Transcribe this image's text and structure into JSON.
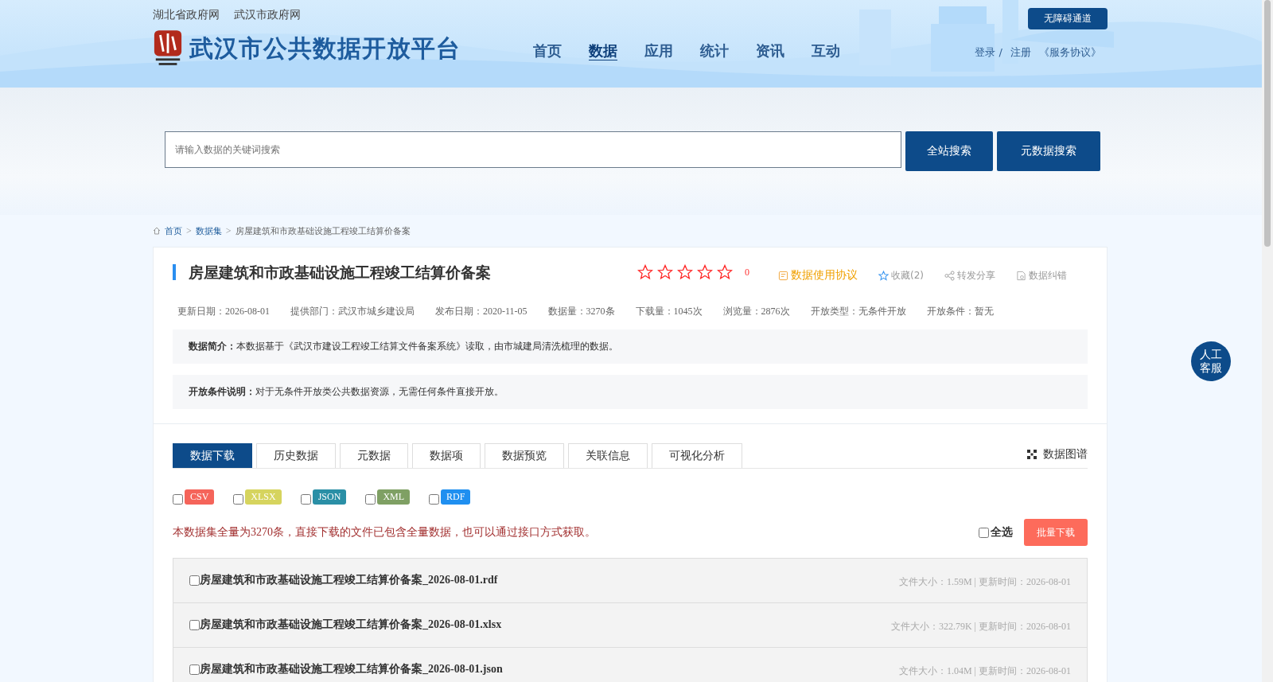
{
  "top_links": [
    "湖北省政府网",
    "武汉市政府网"
  ],
  "accessibility_button": "无障碍通道",
  "site_title": "武汉市公共数据开放平台",
  "nav": [
    {
      "label": "首页",
      "selected": false
    },
    {
      "label": "数据",
      "selected": true
    },
    {
      "label": "应用",
      "selected": false
    },
    {
      "label": "统计",
      "selected": false
    },
    {
      "label": "资讯",
      "selected": false
    },
    {
      "label": "互动",
      "selected": false
    }
  ],
  "user_links": {
    "login": "登录 /",
    "register": "注册",
    "agreement": "《服务协议》"
  },
  "search": {
    "placeholder": "请输入数据的关键词搜索",
    "buttons": [
      "全站搜索",
      "元数据搜索"
    ]
  },
  "breadcrumb": [
    {
      "label": "首页",
      "link": true
    },
    {
      "separator": ">",
      "label": "数据集",
      "link": true
    },
    {
      "separator": ">",
      "label": "房屋建筑和市政基础设施工程竣工结算价备案",
      "link": false
    }
  ],
  "dataset": {
    "title": "房屋建筑和市政基础设施工程竣工结算价备案",
    "stars": 0,
    "rating": "0",
    "actions": [
      {
        "kind": "agreement",
        "label": "数据使用协议"
      },
      {
        "kind": "favorite",
        "label": "收藏(2)"
      },
      {
        "kind": "share",
        "label": "转发分享"
      },
      {
        "kind": "report",
        "label": "数据纠错"
      }
    ],
    "meta": [
      "更新日期：2026-08-01",
      "提供部门：武汉市城乡建设局",
      "发布日期：2020-11-05",
      "数据量：3270条",
      "下载量：1045次",
      "浏览量：2876次",
      "开放类型：无条件开放",
      "开放条件：暂无"
    ],
    "notes": [
      {
        "label": "数据简介：",
        "text": "本数据基于《武汉市建设工程竣工结算文件备案系统》读取，由市城建局清洗梳理的数据。"
      },
      {
        "label": "开放条件说明：",
        "text": "对于无条件开放类公共数据资源，无需任何条件直接开放。"
      }
    ]
  },
  "tabs": [
    {
      "label": "数据下载",
      "selected": true
    },
    {
      "label": "历史数据",
      "selected": false
    },
    {
      "label": "元数据",
      "selected": false
    },
    {
      "label": "数据项",
      "selected": false
    },
    {
      "label": "数据预览",
      "selected": false
    },
    {
      "label": "关联信息",
      "selected": false
    },
    {
      "label": "可视化分析",
      "selected": false
    }
  ],
  "graph_link": "数据图谱",
  "formats": [
    {
      "label": "CSV",
      "checked": false,
      "color": "#f5645a"
    },
    {
      "label": "XLSX",
      "checked": false,
      "color": "#d6d45e"
    },
    {
      "label": "JSON",
      "checked": false,
      "color": "#2a8fa6"
    },
    {
      "label": "XML",
      "checked": false,
      "color": "#7fa064"
    },
    {
      "label": "RDF",
      "checked": false,
      "color": "#1f8ff0"
    }
  ],
  "notice": "本数据集全量为3270条，直接下载的文件已包含全量数据，也可以通过接口方式获取。",
  "select_all": {
    "label": "全选",
    "checked": false
  },
  "batch_button": "批量下载",
  "files": [
    {
      "name": "房屋建筑和市政基础设施工程竣工结算价备案_2026-08-01.rdf",
      "checked": false,
      "info": "文件大小：1.59M | 更新时间：2026-08-01"
    },
    {
      "name": "房屋建筑和市政基础设施工程竣工结算价备案_2026-08-01.xlsx",
      "checked": false,
      "info": "文件大小：322.79K | 更新时间：2026-08-01"
    },
    {
      "name": "房屋建筑和市政基础设施工程竣工结算价备案_2026-08-01.json",
      "checked": false,
      "info": "文件大小：1.04M | 更新时间：2026-08-01"
    }
  ],
  "service_button": "人工客服"
}
